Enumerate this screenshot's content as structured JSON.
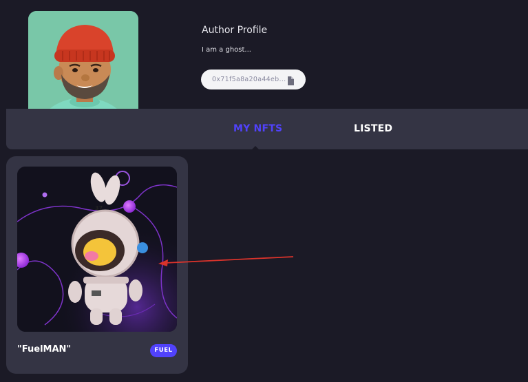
{
  "profile": {
    "title": "Author Profile",
    "bio": "I am a ghost...",
    "wallet_address": "0x71f5a8a20a44eb...",
    "avatar_icon": "cartoon-avatar-red-beanie",
    "copy_icon": "copy-icon"
  },
  "tabs": [
    {
      "label": "MY NFTS",
      "active": true
    },
    {
      "label": "LISTED",
      "active": false
    }
  ],
  "nft_cards": [
    {
      "name": "\"FuelMAN\"",
      "tag": "FUEL",
      "image_icon": "astronaut-bunny-nft"
    }
  ],
  "colors": {
    "background": "#1b1a26",
    "surface": "#343444",
    "accent": "#5142fc",
    "avatar_bg": "#79c7a8",
    "annotation_arrow": "#d9332b"
  }
}
